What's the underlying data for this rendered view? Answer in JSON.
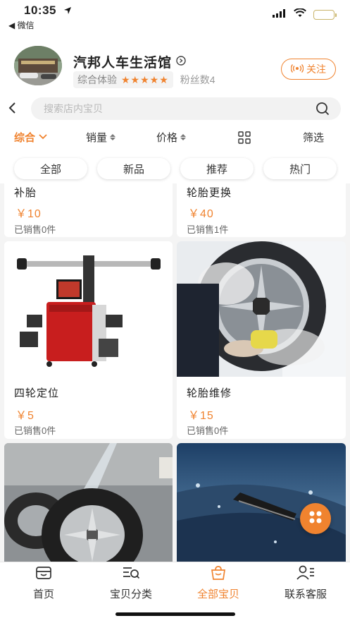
{
  "status_bar": {
    "time": "10:35",
    "back_label": "◀ 微信"
  },
  "shop": {
    "name": "汽邦人车生活馆",
    "rating_label": "综合体验",
    "stars": "★★★★★",
    "fans": "粉丝数4",
    "follow_label": "关注"
  },
  "search": {
    "placeholder": "搜索店内宝贝"
  },
  "sort": {
    "items": [
      "综合",
      "销量",
      "价格",
      "筛选"
    ]
  },
  "chips": [
    "全部",
    "新品",
    "推荐",
    "热门"
  ],
  "products": [
    {
      "title": "补胎",
      "price": "￥10",
      "sold": "已销售0件"
    },
    {
      "title": "轮胎更换",
      "price": "￥40",
      "sold": "已销售1件"
    },
    {
      "title": "四轮定位",
      "price": "￥5",
      "sold": "已销售0件"
    },
    {
      "title": "轮胎维修",
      "price": "￥15",
      "sold": "已销售0件"
    },
    {
      "title": "",
      "price": "",
      "sold": ""
    },
    {
      "title": "",
      "price": "",
      "sold": ""
    }
  ],
  "tabbar": {
    "items": [
      "首页",
      "宝贝分类",
      "全部宝贝",
      "联系客服"
    ],
    "active_index": 2
  },
  "colors": {
    "accent": "#f0832f",
    "background": "#f4f4f4"
  },
  "icons": [
    "location-arrow-icon",
    "signal-icon",
    "wifi-icon",
    "battery-icon",
    "verified-icon",
    "broadcast-icon",
    "back-chevron-icon",
    "search-icon",
    "grid-view-icon",
    "dropdown-icon",
    "sort-arrows-icon",
    "home-icon",
    "category-icon",
    "bag-icon",
    "contact-icon",
    "menu-fab-icon"
  ]
}
